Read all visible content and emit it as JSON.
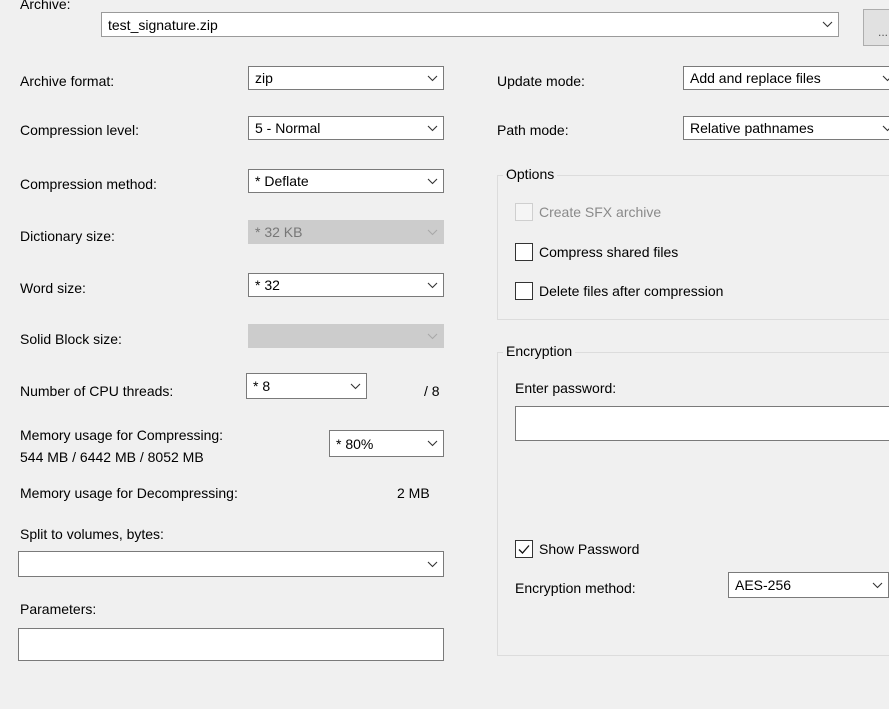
{
  "archive": {
    "label": "Archive:",
    "value": "test_signature.zip",
    "browse_label": "..."
  },
  "left": {
    "archive_format": {
      "label": "Archive format:",
      "value": "zip"
    },
    "compression_level": {
      "label": "Compression level:",
      "value": "5 - Normal"
    },
    "compression_method": {
      "label": "Compression method:",
      "value": "* Deflate"
    },
    "dictionary_size": {
      "label": "Dictionary size:",
      "value": "* 32 KB"
    },
    "word_size": {
      "label": "Word size:",
      "value": "* 32"
    },
    "solid_block_size": {
      "label": "Solid Block size:",
      "value": ""
    },
    "cpu_threads": {
      "label": "Number of CPU threads:",
      "value": "* 8",
      "max": "/ 8"
    },
    "memory_compressing": {
      "label": "Memory usage for Compressing:",
      "detail": "544 MB / 6442 MB / 8052 MB",
      "value": "* 80%"
    },
    "memory_decompressing": {
      "label": "Memory usage for Decompressing:",
      "value": "2 MB"
    },
    "split_volumes": {
      "label": "Split to volumes, bytes:",
      "value": ""
    },
    "parameters": {
      "label": "Parameters:",
      "value": ""
    }
  },
  "right": {
    "update_mode": {
      "label": "Update mode:",
      "value": "Add and replace files"
    },
    "path_mode": {
      "label": "Path mode:",
      "value": "Relative pathnames"
    },
    "options": {
      "legend": "Options",
      "create_sfx": {
        "label": "Create SFX archive",
        "checked": false
      },
      "compress_shared": {
        "label": "Compress shared files",
        "checked": false
      },
      "delete_after": {
        "label": "Delete files after compression",
        "checked": false
      }
    },
    "encryption": {
      "legend": "Encryption",
      "password_label": "Enter password:",
      "password_value": "",
      "show_password": {
        "label": "Show Password",
        "checked": true
      },
      "method_label": "Encryption method:",
      "method_value": "AES-256"
    }
  },
  "icons": {
    "dropdown": "chevron-down-icon",
    "check": "checkmark-icon"
  }
}
